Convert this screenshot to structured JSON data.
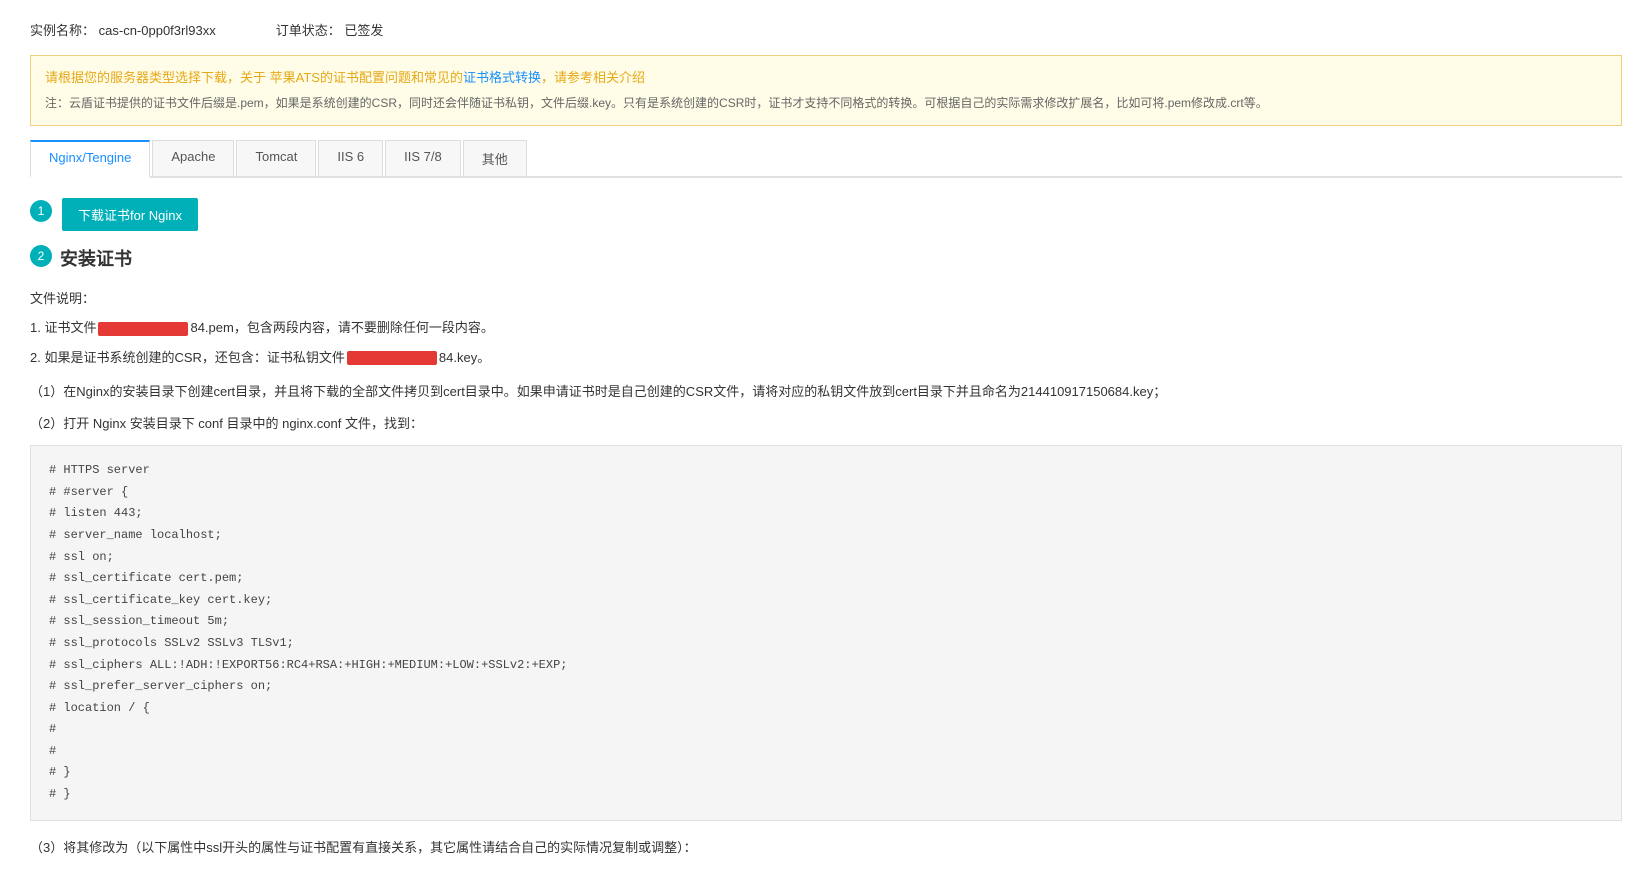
{
  "page": {
    "instance_label": "实例名称：",
    "instance_name": "cas-cn-0pp0f3rl93xx",
    "order_label": "订单状态：",
    "order_status": "已签发",
    "alert": {
      "title_text": "请根据您的服务器类型选择下载",
      "title_suffix": "，关于 苹果ATS的证书配置问题和常见的",
      "link_cert_format": "证书格式转换",
      "title_end": "，请参考相关介绍",
      "note": "注：云盾证书提供的证书文件后缀是.pem，如果是系统创建的CSR，同时还会伴随证书私钥，文件后缀.key。只有是系统创建的CSR时，证书才支持不同格式的转换。可根据自己的实际需求修改扩展名，比如可将.pem修改成.crt等。"
    },
    "tabs": [
      {
        "label": "Nginx/Tengine",
        "active": true
      },
      {
        "label": "Apache",
        "active": false
      },
      {
        "label": "Tomcat",
        "active": false
      },
      {
        "label": "IIS 6",
        "active": false
      },
      {
        "label": "IIS 7/8",
        "active": false
      },
      {
        "label": "其他",
        "active": false
      }
    ],
    "step1": {
      "badge": "1",
      "button_label": "下载证书for Nginx"
    },
    "step2": {
      "badge": "2",
      "title": "安装证书",
      "file_desc_title": "文件说明：",
      "file_item1_prefix": "1. 证书文件",
      "file_item1_redacted": "████████████",
      "file_item1_suffix": "84.pem，包含两段内容，请不要删除任何一段内容。",
      "file_item2_prefix": "2. 如果是证书系统创建的CSR，还包含：证书私钥文件",
      "file_item2_redacted": "████████████",
      "file_item2_suffix": "84.key。",
      "instruction1": "（1）在Nginx的安装目录下创建cert目录，并且将下载的全部文件拷贝到cert目录中。如果申请证书时是自己创建的CSR文件，请将对应的私钥文件放到cert目录下并且命名为214410917150684.key；",
      "instruction2": "（2）打开 Nginx 安装目录下 conf 目录中的 nginx.conf 文件，找到：",
      "code": "# HTTPS server\n# #server {\n# listen 443;\n# server_name localhost;\n# ssl on;\n# ssl_certificate cert.pem;\n# ssl_certificate_key cert.key;\n# ssl_session_timeout 5m;\n# ssl_protocols SSLv2 SSLv3 TLSv1;\n# ssl_ciphers ALL:!ADH:!EXPORT56:RC4+RSA:+HIGH:+MEDIUM:+LOW:+SSLv2:+EXP;\n# ssl_prefer_server_ciphers on;\n# location / {\n#\n#\n# }\n# }",
      "instruction3": "（3）将其修改为（以下属性中ssl开头的属性与证书配置有直接关系，其它属性请结合自己的实际情况复制或调整）："
    }
  }
}
